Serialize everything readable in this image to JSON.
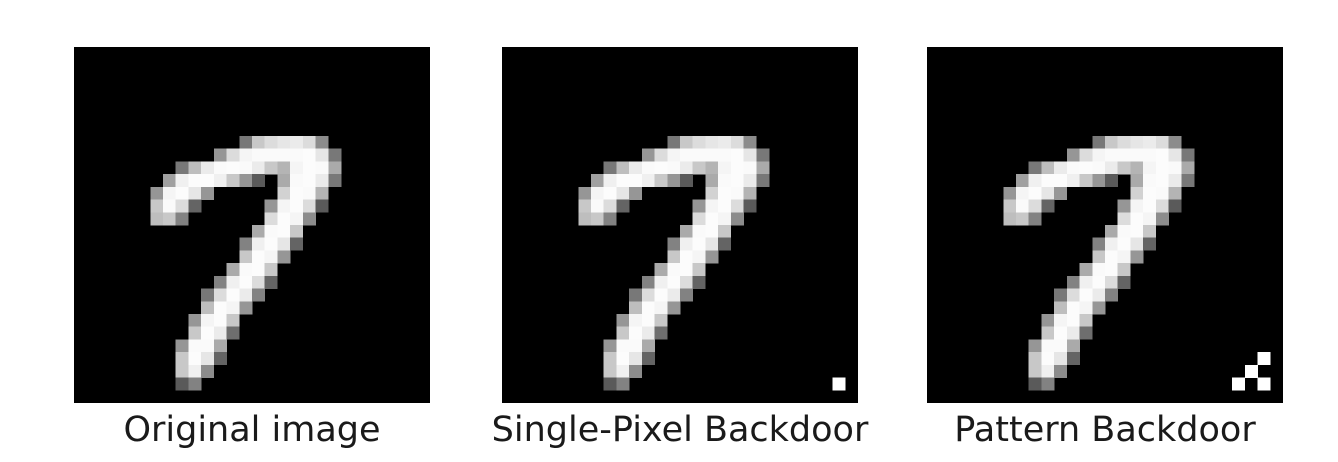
{
  "figure": {
    "panels": [
      {
        "id": "original",
        "caption": "Original image",
        "trigger": "none"
      },
      {
        "id": "single",
        "caption": "Single-Pixel Backdoor",
        "trigger": "single-pixel"
      },
      {
        "id": "pattern",
        "caption": "Pattern Backdoor",
        "trigger": "pattern"
      }
    ]
  },
  "colors": {
    "background": "#000000",
    "stroke": "#ffffff"
  }
}
